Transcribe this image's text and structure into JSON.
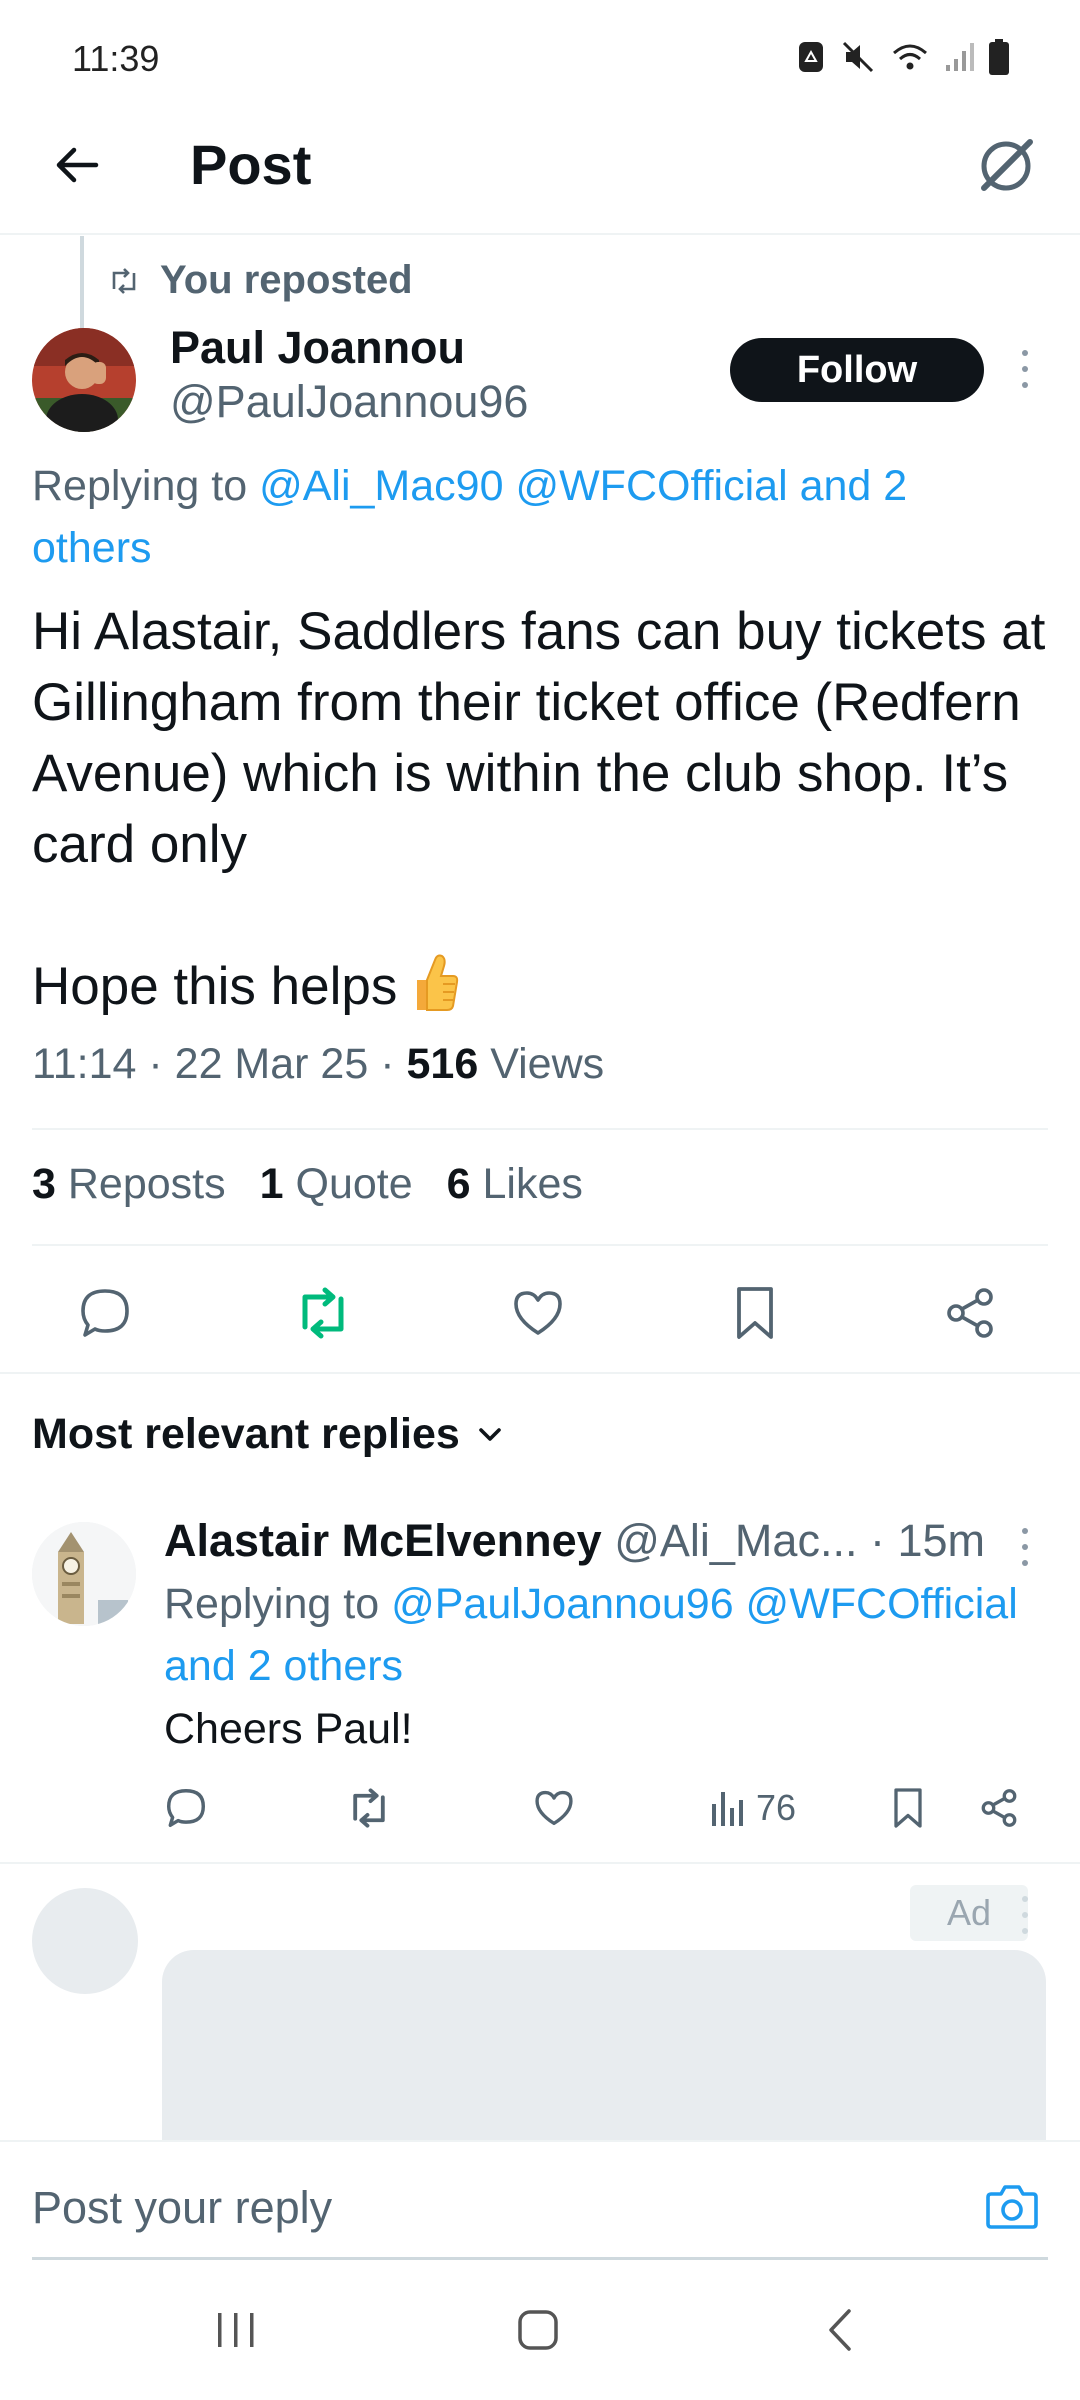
{
  "status_bar": {
    "time": "11:39"
  },
  "header": {
    "title": "Post"
  },
  "repost_context": {
    "label": "You reposted"
  },
  "post": {
    "author_name": "Paul Joannou",
    "author_handle": "@PaulJoannou96",
    "follow_label": "Follow",
    "replying_prefix": "Replying to ",
    "replying_links": "@Ali_Mac90 @WFCOfficial and 2 others",
    "text": "Hi Alastair, Saddlers fans can buy tickets at Gillingham from their ticket office (Redfern Avenue) which is within the club shop. It’s card only\n\nHope this helps",
    "time": "11:14",
    "date": "22 Mar 25",
    "views_count": "516",
    "views_label": "Views",
    "separator": "·",
    "stats": {
      "reposts_count": "3",
      "reposts_label": "Reposts",
      "quotes_count": "1",
      "quotes_label": "Quote",
      "likes_count": "6",
      "likes_label": "Likes"
    },
    "reposted_color": "#00ba7c"
  },
  "replies_section": {
    "sort_label": "Most relevant replies"
  },
  "reply": {
    "name": "Alastair McElvenney",
    "handle": "@Ali_Mac...",
    "time": "· 15m",
    "replying_prefix": "Replying to ",
    "replying_links": "@PaulJoannou96 @WFCOfficial and 2 others",
    "text": "Cheers Paul!",
    "views": "76"
  },
  "ad": {
    "badge": "Ad"
  },
  "composer": {
    "placeholder": "Post your reply"
  },
  "colors": {
    "link": "#1d9bf0",
    "primary_text": "#0f1419",
    "secondary_text": "#536471"
  }
}
